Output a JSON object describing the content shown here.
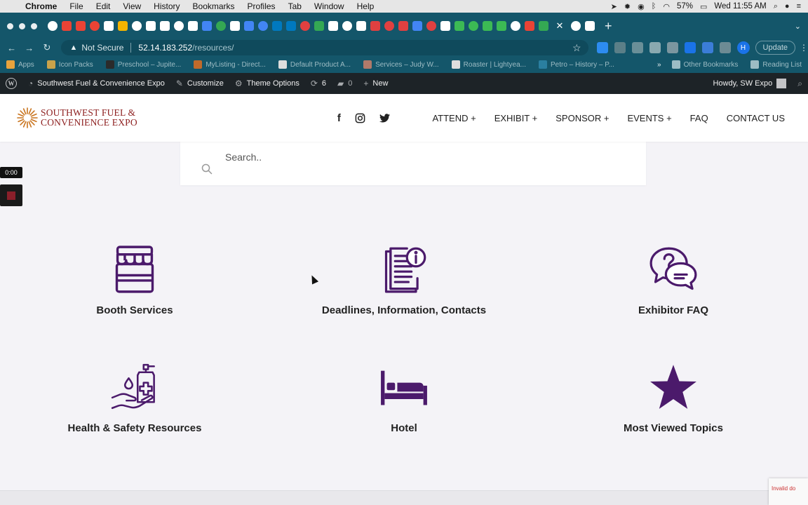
{
  "mac": {
    "menus": [
      "Chrome",
      "File",
      "Edit",
      "View",
      "History",
      "Bookmarks",
      "Profiles",
      "Tab",
      "Window",
      "Help"
    ],
    "battery": "57%",
    "datetime": "Wed 11:55 AM"
  },
  "browser": {
    "address_security": "Not Secure",
    "address_host": "52.14.183.252",
    "address_path": "/resources/",
    "update_label": "Update",
    "profile_initial": "H",
    "tab_close": "✕",
    "new_tab": "+"
  },
  "bookmarks": {
    "items": [
      {
        "label": "Apps",
        "color": "#e8a33d"
      },
      {
        "label": "Icon Packs",
        "color": "#c9a24a"
      },
      {
        "label": "Preschool – Jupite...",
        "color": "#2b2b2b"
      },
      {
        "label": "MyListing - Direct...",
        "color": "#c06a2a"
      },
      {
        "label": "Default Product A...",
        "color": "#dddddd"
      },
      {
        "label": "Services – Judy W...",
        "color": "#b07a6a"
      },
      {
        "label": "Roaster | Lightyea...",
        "color": "#dddddd"
      },
      {
        "label": "Petro – History – P...",
        "color": "#2a7fa0"
      }
    ],
    "more": "»",
    "other": "Other Bookmarks",
    "reading": "Reading List"
  },
  "wpadmin": {
    "site_name": "Southwest Fuel & Convenience Expo",
    "customize": "Customize",
    "theme_options": "Theme Options",
    "updates_count": "6",
    "comments_count": "0",
    "new_label": "New",
    "howdy": "Howdy, SW Expo"
  },
  "site": {
    "logo_line1": "SOUTHWEST FUEL &",
    "logo_line2": "CONVENIENCE EXPO",
    "nav": [
      "ATTEND +",
      "EXHIBIT +",
      "SPONSOR +",
      "EVENTS +",
      "FAQ",
      "CONTACT US"
    ],
    "search_placeholder": "Search.."
  },
  "recorder": {
    "time": "0:00"
  },
  "resources": [
    {
      "label": "Booth Services",
      "icon": "booth-icon"
    },
    {
      "label": "Deadlines, Information, Contacts",
      "icon": "document-info-icon"
    },
    {
      "label": "Exhibitor FAQ",
      "icon": "faq-chat-icon"
    },
    {
      "label": "Health & Safety Resources",
      "icon": "sanitizer-hand-icon"
    },
    {
      "label": "Hotel",
      "icon": "bed-icon"
    },
    {
      "label": "Most Viewed Topics",
      "icon": "star-icon"
    }
  ],
  "recaptcha_text": "Invalid do",
  "colors": {
    "accent_purple": "#4b1a6b",
    "logo_red": "#8c1d1d",
    "browser_teal": "#14566a",
    "wp_bar": "#1d2327"
  }
}
